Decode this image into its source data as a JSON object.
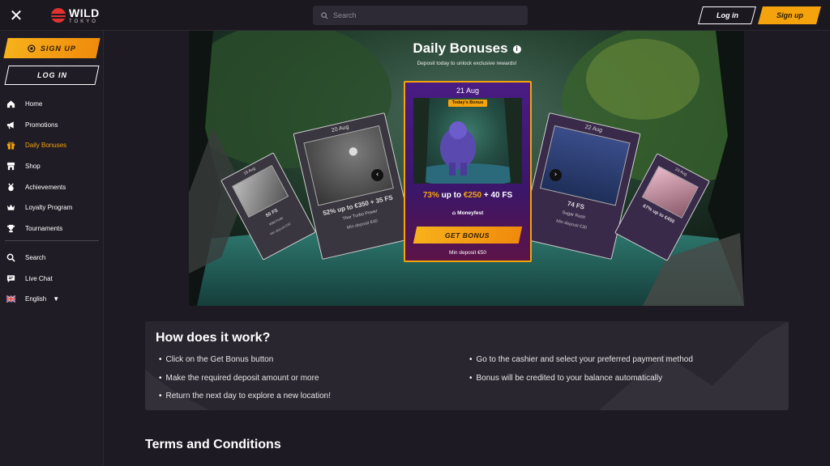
{
  "header": {
    "logo_word": "WILD",
    "logo_sub": "TOKYO",
    "search_placeholder": "Search",
    "login_label": "Log in",
    "signup_label": "Sign up"
  },
  "sidebar": {
    "signup_label": "SIGN UP",
    "login_label": "LOG IN",
    "items": [
      {
        "label": "Home",
        "icon": "home-icon"
      },
      {
        "label": "Promotions",
        "icon": "megaphone-icon"
      },
      {
        "label": "Daily Bonuses",
        "icon": "gift-icon",
        "active": true
      },
      {
        "label": "Shop",
        "icon": "shop-icon"
      },
      {
        "label": "Achievements",
        "icon": "medal-icon"
      },
      {
        "label": "Loyalty Program",
        "icon": "crown-icon"
      },
      {
        "label": "Tournaments",
        "icon": "trophy-icon"
      }
    ],
    "items2": [
      {
        "label": "Search",
        "icon": "search-icon"
      },
      {
        "label": "Live Chat",
        "icon": "chat-icon"
      },
      {
        "label": "English",
        "icon": "uk-flag-icon"
      }
    ]
  },
  "hero": {
    "title": "Daily Bonuses",
    "subtitle": "Deposit today to unlock exclusive rewards!",
    "main_card": {
      "date": "21 Aug",
      "badge": "Today's Bonus",
      "offer_percent": "73%",
      "offer_mid": " up to ",
      "offer_amount": "€250",
      "offer_fs": " + 40 FS",
      "game": "Moneyfest",
      "button": "GET BONUS",
      "min_deposit": "Min deposit €50"
    },
    "left_card": {
      "date": "20 Aug",
      "offer": "52% up to €350 + 35 FS",
      "game": "Thor Turbo Power",
      "min": "Min deposit €40"
    },
    "far_left_card": {
      "date": "19 Aug",
      "offer": "50 FS",
      "game": "Wild Fruits",
      "min": "Min deposit €30"
    },
    "right_card": {
      "date": "22 Aug",
      "offer": "74 FS",
      "game": "Sugar Rush",
      "min": "Min deposit €30"
    },
    "far_right_card": {
      "date": "23 Aug",
      "offer": "67% up to €450",
      "game": "",
      "min": ""
    }
  },
  "how": {
    "title": "How does it work?",
    "left": [
      "Click on the Get Bonus button",
      "Make the required deposit amount or more",
      "Return the next day to explore a new location!"
    ],
    "right": [
      "Go to the cashier and select your preferred payment method",
      "Bonus will be credited to your balance automatically"
    ]
  },
  "terms_title": "Terms and Conditions",
  "colors": {
    "accent": "#f5a30c",
    "bg": "#1e1a24",
    "card_purple": "#4a1c84"
  }
}
